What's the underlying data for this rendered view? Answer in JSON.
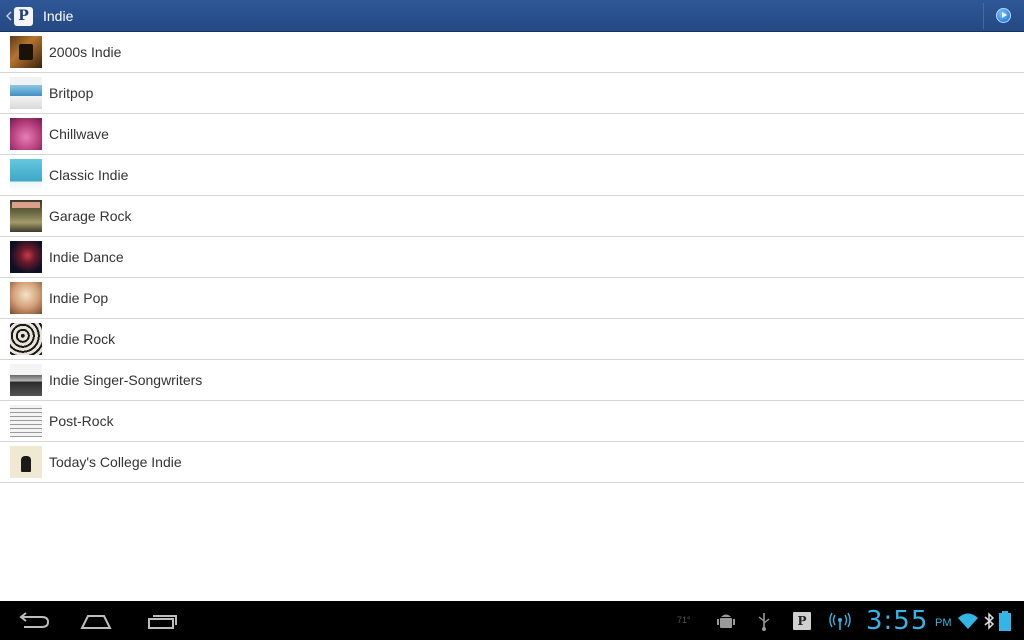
{
  "action_bar": {
    "title": "Indie",
    "app_icon_letter": "P",
    "accent_color": "#2a5090"
  },
  "genres": [
    {
      "label": "2000s Indie"
    },
    {
      "label": "Britpop"
    },
    {
      "label": "Chillwave"
    },
    {
      "label": "Classic Indie"
    },
    {
      "label": "Garage Rock"
    },
    {
      "label": "Indie Dance"
    },
    {
      "label": "Indie Pop"
    },
    {
      "label": "Indie Rock"
    },
    {
      "label": "Indie Singer-Songwriters"
    },
    {
      "label": "Post-Rock"
    },
    {
      "label": "Today's College Indie"
    }
  ],
  "system_bar": {
    "temperature": "71°",
    "notification_app_letter": "P",
    "time": "3:55",
    "ampm": "PM",
    "clock_color": "#33b5e5",
    "icons": [
      "back-icon",
      "home-icon",
      "recent-apps-icon",
      "android-debug-icon",
      "usb-icon",
      "pandora-notification-icon",
      "wireless-signal-icon",
      "wifi-icon",
      "bluetooth-icon",
      "battery-icon"
    ]
  }
}
